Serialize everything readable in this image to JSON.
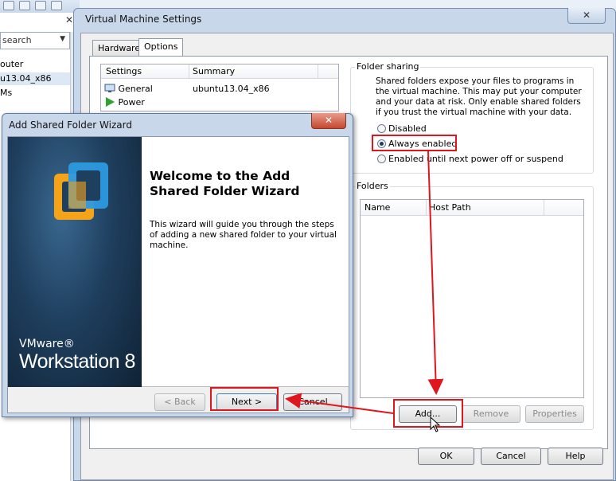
{
  "bg_app": {
    "search_placeholder": "search",
    "close": "✕",
    "items": [
      "outer",
      "u13.04_x86",
      "Ms"
    ]
  },
  "vm_settings": {
    "title": "Virtual Machine Settings",
    "close_icon": "close-icon",
    "tabs": [
      {
        "label": "Hardware"
      },
      {
        "label": "Options"
      }
    ],
    "settings_table": {
      "columns": [
        "Settings",
        "Summary"
      ],
      "rows": [
        {
          "name": "General",
          "summary": "ubuntu13.04_x86",
          "icon": "monitor-icon"
        },
        {
          "name": "Power",
          "summary": "",
          "icon": "play-icon"
        }
      ]
    },
    "folder_sharing": {
      "group_label": "Folder sharing",
      "description": "Shared folders expose your files to programs in the virtual machine. This may put your computer and your data at risk. Only enable shared folders if you trust the virtual machine with your data.",
      "options": [
        {
          "label": "Disabled",
          "selected": false
        },
        {
          "label": "Always enabled",
          "selected": true
        },
        {
          "label": "Enabled until next power off or suspend",
          "selected": false
        }
      ]
    },
    "folders": {
      "group_label": "Folders",
      "columns": [
        "Name",
        "Host Path"
      ],
      "buttons": {
        "add": "Add...",
        "remove": "Remove",
        "properties": "Properties"
      }
    },
    "footer": {
      "ok": "OK",
      "cancel": "Cancel",
      "help": "Help"
    }
  },
  "wizard": {
    "title": "Add Shared Folder Wizard",
    "close": "✕",
    "heading": "Welcome to the Add Shared Folder Wizard",
    "body": "This wizard will guide you through the steps of adding a new shared folder to your virtual machine.",
    "brand_line1": "VMware®",
    "brand_line2": "Workstation 8",
    "buttons": {
      "back": "< Back",
      "next": "Next >",
      "cancel": "Cancel"
    }
  },
  "colors": {
    "annotation": "#e0161e",
    "title_bar": "#c8d8ea",
    "wizard_side": "#1f3f5e"
  }
}
